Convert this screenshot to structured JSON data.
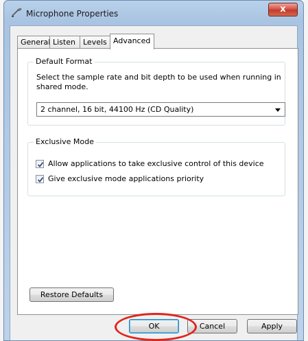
{
  "window": {
    "title": "Microphone Properties",
    "close_label": "x"
  },
  "tabs": [
    {
      "label": "General",
      "active": false
    },
    {
      "label": "Listen",
      "active": false
    },
    {
      "label": "Levels",
      "active": false
    },
    {
      "label": "Advanced",
      "active": true
    }
  ],
  "default_format": {
    "group_label": "Default Format",
    "description": "Select the sample rate and bit depth to be used when running in shared mode.",
    "selected_value": "2 channel, 16 bit, 44100 Hz (CD Quality)"
  },
  "exclusive_mode": {
    "group_label": "Exclusive Mode",
    "options": [
      {
        "label": "Allow applications to take exclusive control of this device",
        "checked": true
      },
      {
        "label": "Give exclusive mode applications priority",
        "checked": true
      }
    ]
  },
  "buttons": {
    "restore_defaults": "Restore Defaults",
    "ok": "OK",
    "cancel": "Cancel",
    "apply": "Apply"
  },
  "colors": {
    "highlight": "#e1231d",
    "close_button": "#c23a2e"
  },
  "icons": {
    "title": "microphone-icon",
    "close": "close-icon",
    "dropdown": "chevron-down-icon",
    "check": "checkmark-icon"
  }
}
